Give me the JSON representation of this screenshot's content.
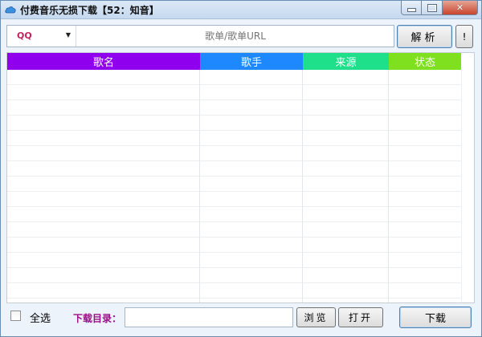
{
  "window": {
    "title": "付费音乐无损下载【52：知音】"
  },
  "toolbar": {
    "source_value": "QQ",
    "url_placeholder": "歌单/歌单URL",
    "parse_label": "解析",
    "info_label": "!"
  },
  "table": {
    "columns": [
      {
        "label": "歌名",
        "color": "#8e00ee"
      },
      {
        "label": "歌手",
        "color": "#1e88ff"
      },
      {
        "label": "来源",
        "color": "#1ee08a"
      },
      {
        "label": "状态",
        "color": "#7ee01e"
      }
    ],
    "rows": []
  },
  "footer": {
    "select_all_label": "全选",
    "select_all_checked": false,
    "dir_label": "下载目录：",
    "dir_value": "",
    "browse_label": "浏览",
    "open_label": "打开",
    "download_label": "下载"
  },
  "colors": {
    "accent_source": "#c0245c",
    "dir_label": "#9b0f87"
  },
  "icons": {
    "app": "cloud-icon",
    "dropdown": "chevron-down-icon"
  }
}
